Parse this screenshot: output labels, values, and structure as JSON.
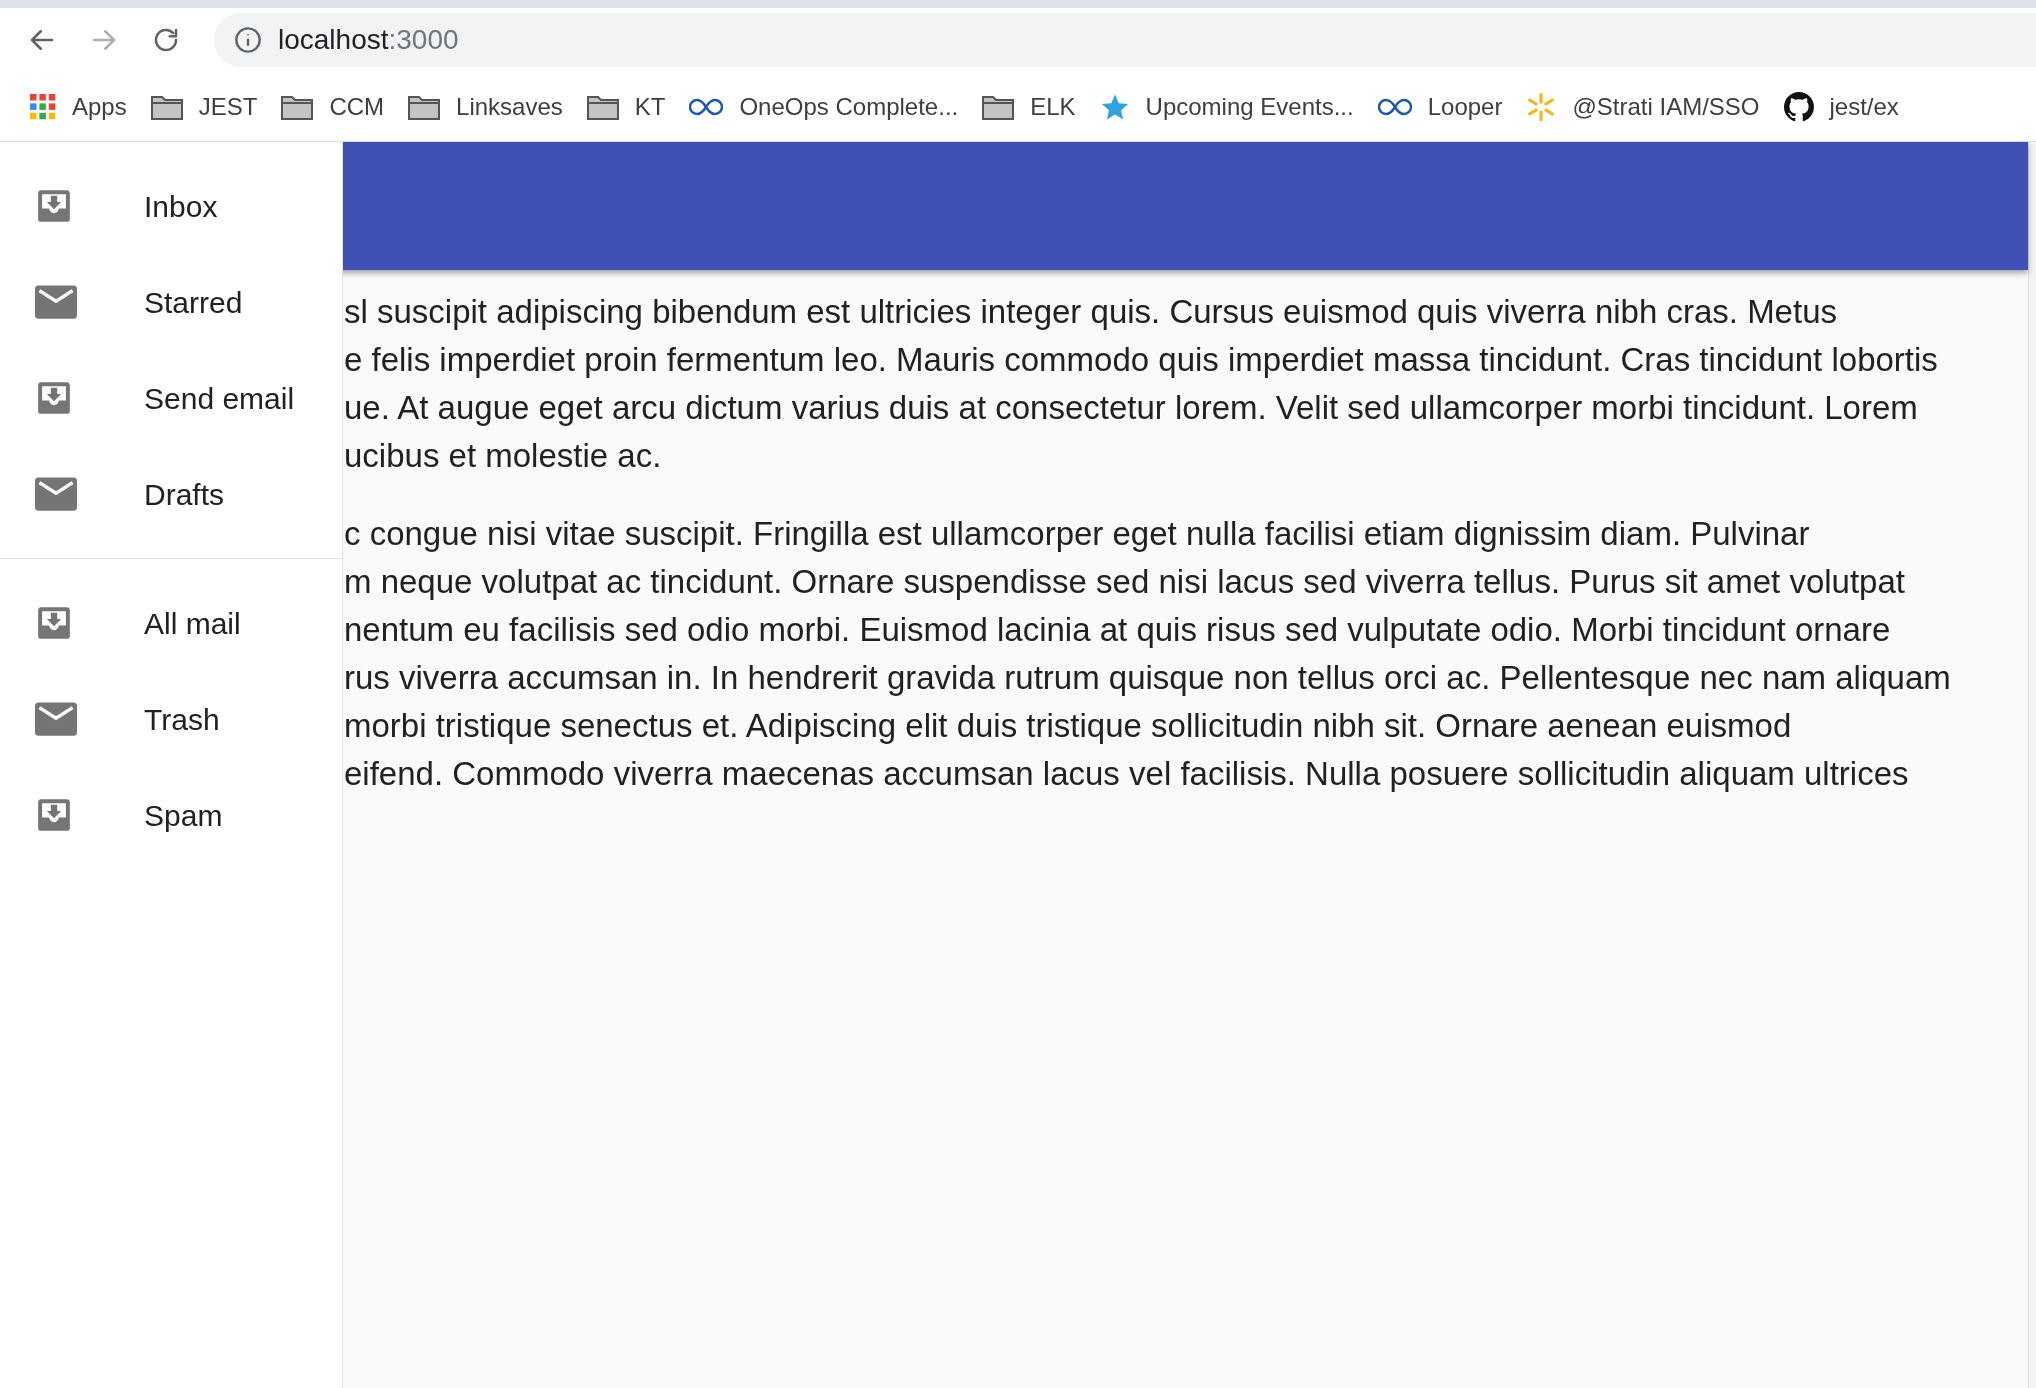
{
  "browser": {
    "nav": [
      {
        "kind": "back",
        "disabled": false
      },
      {
        "kind": "forward",
        "disabled": true
      },
      {
        "kind": "reload",
        "disabled": false
      }
    ],
    "address": {
      "host": "localhost",
      "port": ":3000"
    },
    "bookmarks": [
      {
        "kind": "apps",
        "label": "Apps"
      },
      {
        "kind": "folder",
        "label": "JEST"
      },
      {
        "kind": "folder",
        "label": "CCM"
      },
      {
        "kind": "folder",
        "label": "Linksaves"
      },
      {
        "kind": "folder",
        "label": "KT"
      },
      {
        "kind": "loop",
        "label": "OneOps Complete..."
      },
      {
        "kind": "folder",
        "label": "ELK"
      },
      {
        "kind": "star",
        "label": "Upcoming Events..."
      },
      {
        "kind": "loop",
        "label": "Looper"
      },
      {
        "kind": "spark",
        "label": "@Strati IAM/SSO"
      },
      {
        "kind": "github",
        "label": "jest/ex"
      }
    ]
  },
  "drawer": {
    "sections": [
      [
        {
          "kind": "inbox",
          "label": "Inbox"
        },
        {
          "kind": "mail",
          "label": "Starred"
        },
        {
          "kind": "inbox",
          "label": "Send email"
        },
        {
          "kind": "mail",
          "label": "Drafts"
        }
      ],
      [
        {
          "kind": "inbox",
          "label": "All mail"
        },
        {
          "kind": "mail",
          "label": "Trash"
        },
        {
          "kind": "inbox",
          "label": "Spam"
        }
      ]
    ]
  },
  "content": {
    "paragraphs": [
      [
        "sl suscipit adipiscing bibendum est ultricies integer quis. Cursus euismod quis viverra nibh cras. Metus",
        "e felis imperdiet proin fermentum leo. Mauris commodo quis imperdiet massa tincidunt. Cras tincidunt lobortis",
        "ue. At augue eget arcu dictum varius duis at consectetur lorem. Velit sed ullamcorper morbi tincidunt. Lorem",
        "ucibus et molestie ac."
      ],
      [
        "c congue nisi vitae suscipit. Fringilla est ullamcorper eget nulla facilisi etiam dignissim diam. Pulvinar",
        "m neque volutpat ac tincidunt. Ornare suspendisse sed nisi lacus sed viverra tellus. Purus sit amet volutpat",
        "nentum eu facilisis sed odio morbi. Euismod lacinia at quis risus sed vulputate odio. Morbi tincidunt ornare",
        "rus viverra accumsan in. In hendrerit gravida rutrum quisque non tellus orci ac. Pellentesque nec nam aliquam",
        "morbi tristique senectus et. Adipiscing elit duis tristique sollicitudin nibh sit. Ornare aenean euismod",
        "eifend. Commodo viverra maecenas accumsan lacus vel facilisis. Nulla posuere sollicitudin aliquam ultrices"
      ]
    ]
  }
}
